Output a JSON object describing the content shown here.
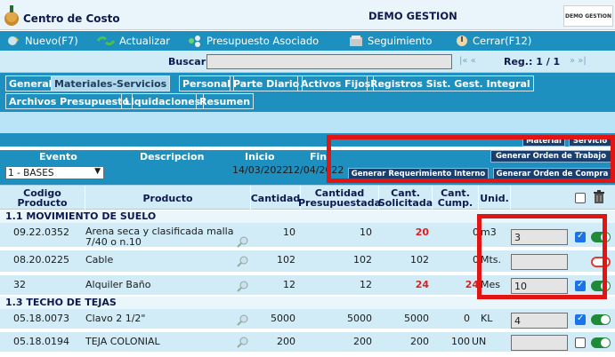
{
  "header": {
    "app_title": "Centro de Costo",
    "company_name": "DEMO GESTION",
    "company_logo_text": "DEMO GESTION"
  },
  "toolbar": {
    "new_label": "Nuevo(F7)",
    "refresh_label": "Actualizar",
    "budget_label": "Presupuesto Asociado",
    "tracking_label": "Seguimiento",
    "close_label": "Cerrar(F12)"
  },
  "search": {
    "label": "Buscar",
    "value": "",
    "nav_prev": "|«  «",
    "reg_label": "Reg.: 1 / 1",
    "nav_next": "»  »|"
  },
  "tabs": [
    {
      "label": "General",
      "active": false
    },
    {
      "label": "Materiales-Servicios",
      "active": true
    },
    {
      "label": "Personal",
      "active": false
    },
    {
      "label": "Parte Diario",
      "active": false
    },
    {
      "label": "Activos Fijos",
      "active": false
    },
    {
      "label": "Registros Sist. Gest. Integral",
      "active": false
    },
    {
      "label": "Archivos Presupuesto",
      "active": false
    },
    {
      "label": "Liquidaciones",
      "active": false
    },
    {
      "label": "Resumen",
      "active": false
    }
  ],
  "actions": {
    "material_label": "Material",
    "service_label": "Servicio",
    "work_order_label": "Generar Orden de Trabajo",
    "internal_req_label": "Generar Requerimiento Interno",
    "purchase_order_label": "Generar Orden de Compra"
  },
  "event_headers": {
    "evento": "Evento",
    "descripcion": "Descripcion",
    "inicio": "Inicio",
    "fin": "Fin"
  },
  "event": {
    "selected": "1 - BASES",
    "start": "14/03/2022",
    "end": "12/04/2022"
  },
  "grid_headers": {
    "code": "Codigo Producto",
    "product": "Producto",
    "qty": "Cantidad",
    "budget_qty": "Cantidad Presupuestada",
    "requested": "Cant. Solicitada",
    "completed": "Cant. Cump.",
    "unit": "Unid."
  },
  "groups": [
    {
      "title": "1.1 MOVIMIENTO DE SUELO",
      "rows": [
        {
          "code": "09.22.0352",
          "product": "Arena seca y clasificada malla 7/40 o n.10",
          "qty": "10",
          "budget": "10",
          "requested": "20",
          "completed": "0",
          "unit": "m3",
          "input": "3",
          "checked": true,
          "toggle": "on"
        },
        {
          "code": "08.20.0225",
          "product": "Cable",
          "qty": "102",
          "budget": "102",
          "requested": "102",
          "completed": "0",
          "unit": "Mts.",
          "input": "",
          "checked": false,
          "toggle": "off"
        },
        {
          "code": "32",
          "product": "Alquiler Baño",
          "qty": "12",
          "budget": "12",
          "requested": "24",
          "completed": "24",
          "unit": "Mes",
          "input": "10",
          "checked": true,
          "toggle": "on"
        }
      ]
    },
    {
      "title": "1.3 TECHO DE TEJAS",
      "rows": [
        {
          "code": "05.18.0073",
          "product": "Clavo 2 1/2\"",
          "qty": "5000",
          "budget": "5000",
          "requested": "5000",
          "completed": "0",
          "unit": "KL",
          "input": "4",
          "checked": true,
          "toggle": "on"
        },
        {
          "code": "05.18.0194",
          "product": "TEJA COLONIAL",
          "qty": "200",
          "budget": "200",
          "requested": "200",
          "completed": "100",
          "unit": "UN",
          "input": "",
          "checked": false,
          "toggle": "on"
        }
      ]
    }
  ],
  "colors": {
    "toolbar_blue": "#1e90bf",
    "light_blue": "#d1ecf7",
    "highlight_red": "#e21414",
    "requested_red": "#e02020",
    "toggle_green": "#1f8a3a"
  }
}
